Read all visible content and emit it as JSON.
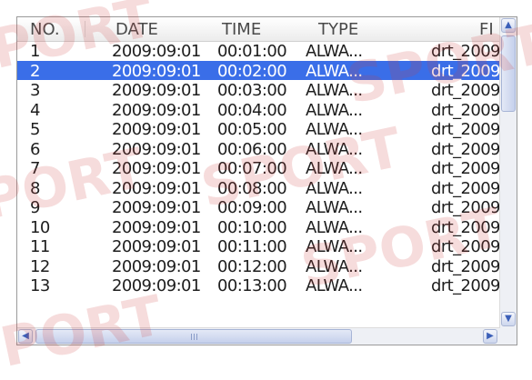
{
  "columns": [
    "NO.",
    "DATE",
    "TIME",
    "TYPE",
    "FI"
  ],
  "rows": [
    {
      "no": "1",
      "date": "2009:09:01",
      "time": "00:01:00",
      "type": "ALWA...",
      "file": "drt_2009("
    },
    {
      "no": "2",
      "date": "2009:09:01",
      "time": "00:02:00",
      "type": "ALWA...",
      "file": "drt_2009(",
      "selected": true
    },
    {
      "no": "3",
      "date": "2009:09:01",
      "time": "00:03:00",
      "type": "ALWA...",
      "file": "drt_2009("
    },
    {
      "no": "4",
      "date": "2009:09:01",
      "time": "00:04:00",
      "type": "ALWA...",
      "file": "drt_2009("
    },
    {
      "no": "5",
      "date": "2009:09:01",
      "time": "00:05:00",
      "type": "ALWA...",
      "file": "drt_2009("
    },
    {
      "no": "6",
      "date": "2009:09:01",
      "time": "00:06:00",
      "type": "ALWA...",
      "file": "drt_2009("
    },
    {
      "no": "7",
      "date": "2009:09:01",
      "time": "00:07:00",
      "type": "ALWA...",
      "file": "drt_2009("
    },
    {
      "no": "8",
      "date": "2009:09:01",
      "time": "00:08:00",
      "type": "ALWA...",
      "file": "drt_2009("
    },
    {
      "no": "9",
      "date": "2009:09:01",
      "time": "00:09:00",
      "type": "ALWA...",
      "file": "drt_2009("
    },
    {
      "no": "10",
      "date": "2009:09:01",
      "time": "00:10:00",
      "type": "ALWA...",
      "file": "drt_2009("
    },
    {
      "no": "11",
      "date": "2009:09:01",
      "time": "00:11:00",
      "type": "ALWA...",
      "file": "drt_2009("
    },
    {
      "no": "12",
      "date": "2009:09:01",
      "time": "00:12:00",
      "type": "ALWA...",
      "file": "drt_2009("
    },
    {
      "no": "13",
      "date": "2009:09:01",
      "time": "00:13:00",
      "type": "ALWA...",
      "file": "drt_2009("
    }
  ],
  "icons": {
    "scroll_up": "scroll-up-arrow-icon",
    "scroll_down": "scroll-down-arrow-icon",
    "scroll_left": "scroll-left-arrow-icon",
    "scroll_right": "scroll-right-arrow-icon"
  },
  "colors": {
    "selection": "#3a6ee8",
    "header_text": "#4a4a4a",
    "row_text": "#1e1e1e",
    "watermark": "#cd3c3c"
  },
  "watermark": [
    "PORT",
    "SPORT",
    "SPORT",
    "PORT",
    "SPORT",
    "PORT"
  ]
}
